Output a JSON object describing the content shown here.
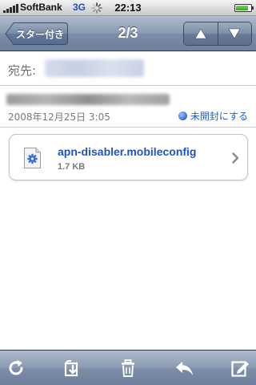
{
  "status_bar": {
    "carrier": "SoftBank",
    "network": "3G",
    "time": "22:13",
    "battery_level": 0.85
  },
  "nav": {
    "back_label": "スター付き",
    "title": "2/3",
    "prev_icon": "up-arrow-icon",
    "next_icon": "down-arrow-icon"
  },
  "header": {
    "to_label": "宛先:",
    "date": "2008年12月25日 3:05",
    "mark_unread_label": "未開封にする"
  },
  "attachment": {
    "name": "apn-disabler.mobileconfig",
    "size": "1.7 KB",
    "icon": "config-file-icon"
  },
  "toolbar": {
    "icons": [
      "refresh-icon",
      "move-folder-icon",
      "trash-icon",
      "reply-icon",
      "compose-icon"
    ]
  },
  "colors": {
    "nav_bar": "#8a9ab1",
    "link_blue": "#1b54c9",
    "unread_dot": "#2f6ae0"
  }
}
